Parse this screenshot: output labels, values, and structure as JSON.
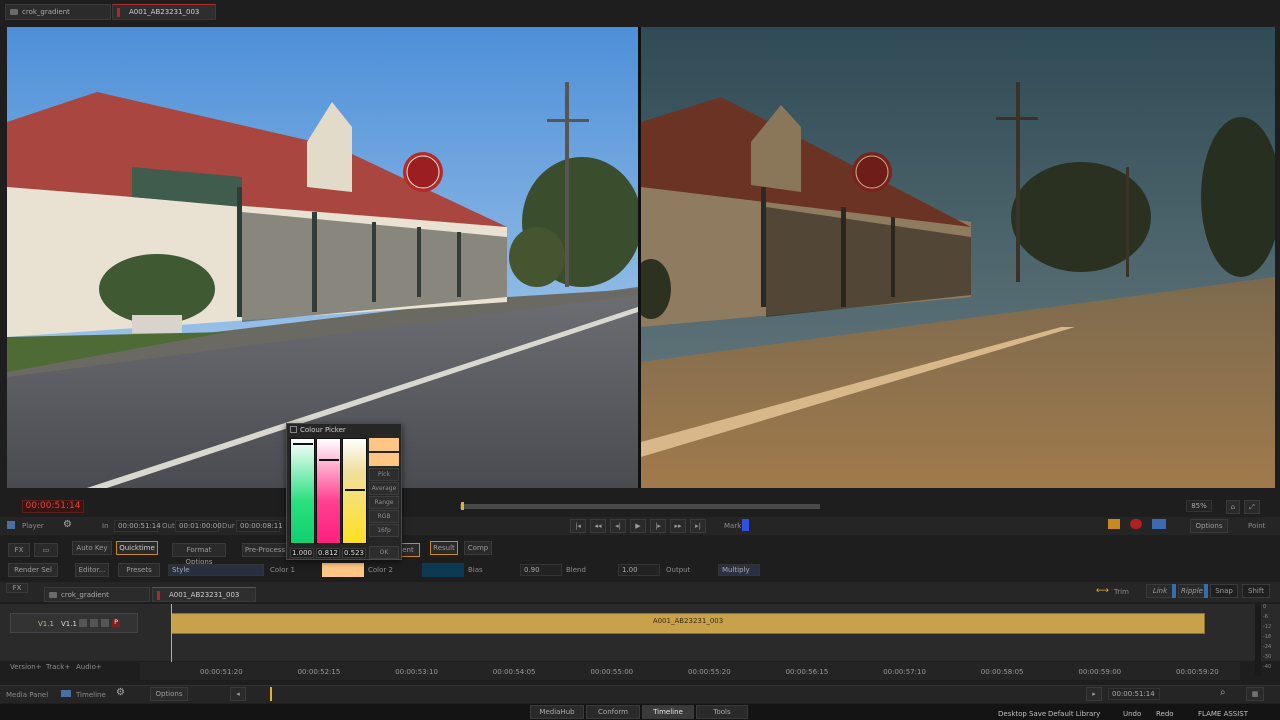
{
  "tabs": [
    {
      "label": "crok_gradient"
    },
    {
      "label": "A001_AB23231_003"
    }
  ],
  "viewer": {
    "left_alt": "source frame (ungraded)",
    "right_alt": "graded frame"
  },
  "transport": {
    "timecode": "00:00:51:14",
    "zoom": "85%",
    "player_label": "Player",
    "in_label": "In",
    "in_value": "00:00:51:14",
    "out_label": "Out",
    "out_value": "00:01:00:00",
    "dur_label": "Dur",
    "dur_value": "00:00:08:11",
    "mark_label": "Mark",
    "options_label": "Options",
    "point_label": "Point"
  },
  "fx_row": {
    "auto_key": "Auto Key",
    "quicktime": "Quicktime",
    "format_options": "Format Options",
    "pre_process": "Pre-Process",
    "agent": "ent",
    "result": "Result",
    "comp": "Comp",
    "fx_label": "FX"
  },
  "param_row": {
    "render_sel": "Render Sel",
    "editor": "Editor...",
    "presets": "Presets",
    "style": "Style",
    "color1": "Color 1",
    "color1_hex": "#ffc683",
    "color2": "Color 2",
    "color2_hex": "#0d3a52",
    "bias_label": "Bias",
    "bias_value": "0.90",
    "blend_label": "Blend",
    "blend_value": "1.00",
    "output_label": "Output",
    "output_value": "Multiply"
  },
  "colour_picker": {
    "title": "Colour Picker",
    "r": "1.000",
    "g": "0.812",
    "b": "0.523",
    "ok": "OK",
    "options": [
      "Pick",
      "Average",
      "Range",
      "RGB",
      "16fp"
    ]
  },
  "timeline": {
    "fx_tab": "FX",
    "tabs": [
      "crok_gradient",
      "A001_AB23231_003"
    ],
    "trim": "Trim",
    "link": "Link",
    "ripple": "Ripple",
    "snap": "Snap",
    "shift": "Shift",
    "track_v": "V1.1",
    "track_v2": "V1.1",
    "track_p": "P",
    "clip_name": "A001_AB23231_003",
    "ruler": [
      "00:00:51:20",
      "00:00:52:15",
      "00:00:53:10",
      "00:00:54:05",
      "00:00:55:00",
      "00:00:55:20",
      "00:00:56:15",
      "00:00:57:10",
      "00:00:58:05",
      "00:00:59:00",
      "00:00:59:20"
    ],
    "version_label": "Version+",
    "track_label": "Track+",
    "audio_label": "Audio+",
    "meter_ticks": [
      "0",
      "-6",
      "-12",
      "-18",
      "-24",
      "-30",
      "-40"
    ]
  },
  "bottom_bar": {
    "media_panel": "Media Panel",
    "timeline": "Timeline",
    "options": "Options",
    "timecode": "00:00:51:14"
  },
  "status_bar": {
    "tabs": [
      "MediaHub",
      "Conform",
      "Timeline",
      "Tools"
    ],
    "desktop": "Desktop",
    "save": "Save",
    "library": "Default Library",
    "undo": "Undo",
    "redo": "Redo",
    "app": "FLAME ASSIST"
  }
}
